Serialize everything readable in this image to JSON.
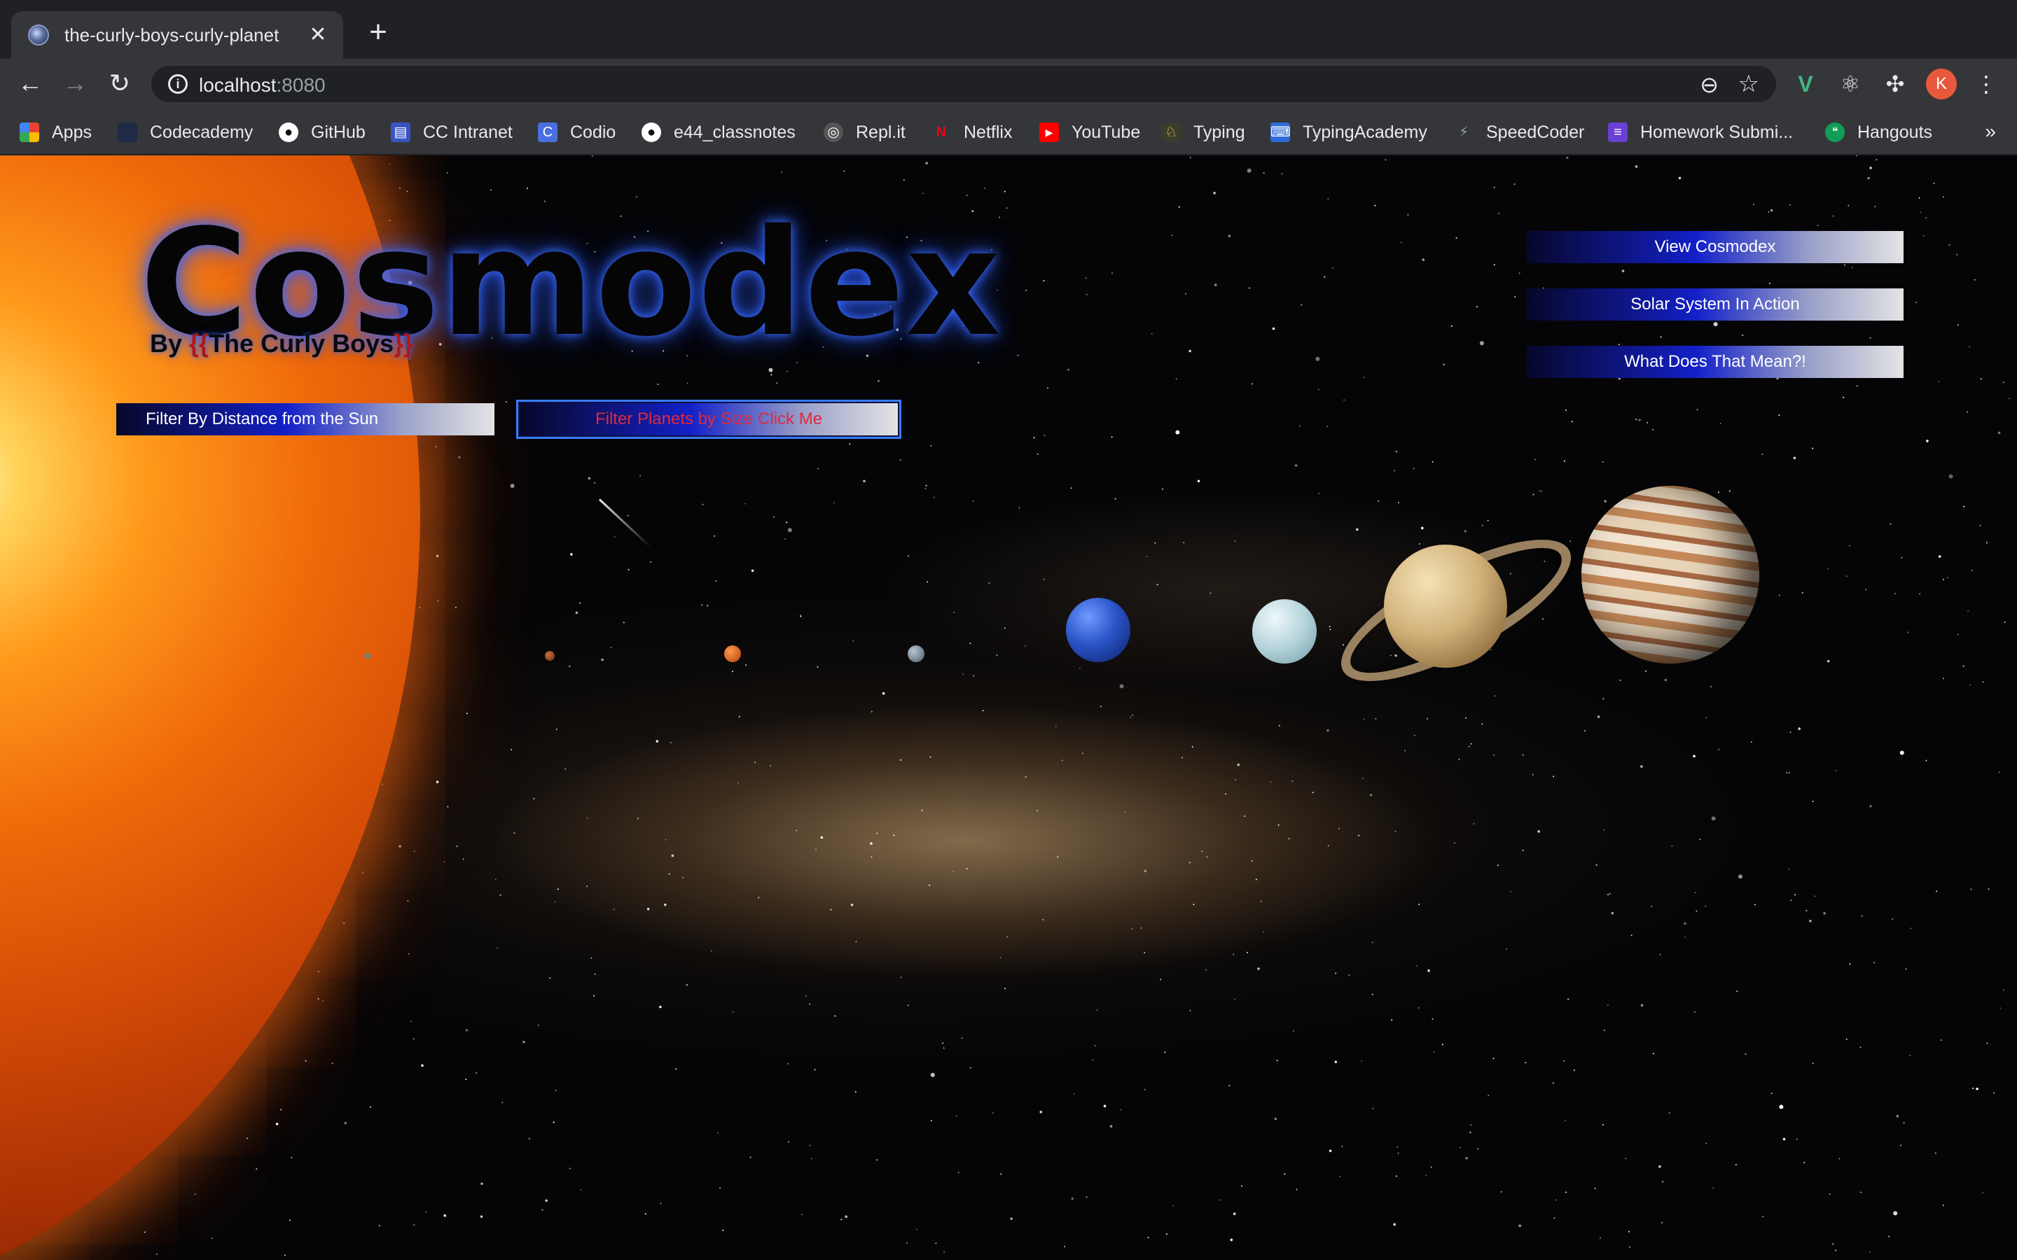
{
  "browser": {
    "tab_title": "the-curly-boys-curly-planet",
    "tab_close": "✕",
    "new_tab": "+",
    "url_host": "localhost",
    "url_port": ":8080",
    "profile_initial": "K",
    "bookmarks": [
      {
        "label": "Apps",
        "icon": "apps-grid-icon"
      },
      {
        "label": "Codecademy",
        "icon": "codecademy-icon"
      },
      {
        "label": "GitHub",
        "icon": "github-icon"
      },
      {
        "label": "CC Intranet",
        "icon": "intranet-icon"
      },
      {
        "label": "Codio",
        "icon": "codio-icon"
      },
      {
        "label": "e44_classnotes",
        "icon": "github-icon"
      },
      {
        "label": "Repl.it",
        "icon": "replit-icon"
      },
      {
        "label": "Netflix",
        "icon": "netflix-icon"
      },
      {
        "label": "YouTube",
        "icon": "youtube-icon"
      },
      {
        "label": "Typing",
        "icon": "typing-icon"
      },
      {
        "label": "TypingAcademy",
        "icon": "typingacademy-icon"
      },
      {
        "label": "SpeedCoder",
        "icon": "speedcoder-icon"
      },
      {
        "label": "Homework Submi...",
        "icon": "homework-icon"
      },
      {
        "label": "Hangouts",
        "icon": "hangouts-icon"
      }
    ],
    "bookmarks_more": "»"
  },
  "page": {
    "logo": "Cosmodex",
    "byline_prefix": "By ",
    "byline_open": "{{",
    "byline_name": "The Curly Boys",
    "byline_close": "}}",
    "filter_distance_label": "Filter By Distance from the Sun",
    "filter_size_label": "Filter Planets by Size Click Me",
    "nav": {
      "view_cosmodex": "View Cosmodex",
      "solar_system": "Solar System In Action",
      "what_does_that_mean": "What Does That Mean?!"
    }
  },
  "colors": {
    "button_gradient_start": "#07072a",
    "button_gradient_mid": "#1320c8",
    "button_gradient_end": "#e4e4e4",
    "focused_text": "#e02a3b",
    "logo_glow": "#3c6eff",
    "byline_curly": "#b01818"
  }
}
